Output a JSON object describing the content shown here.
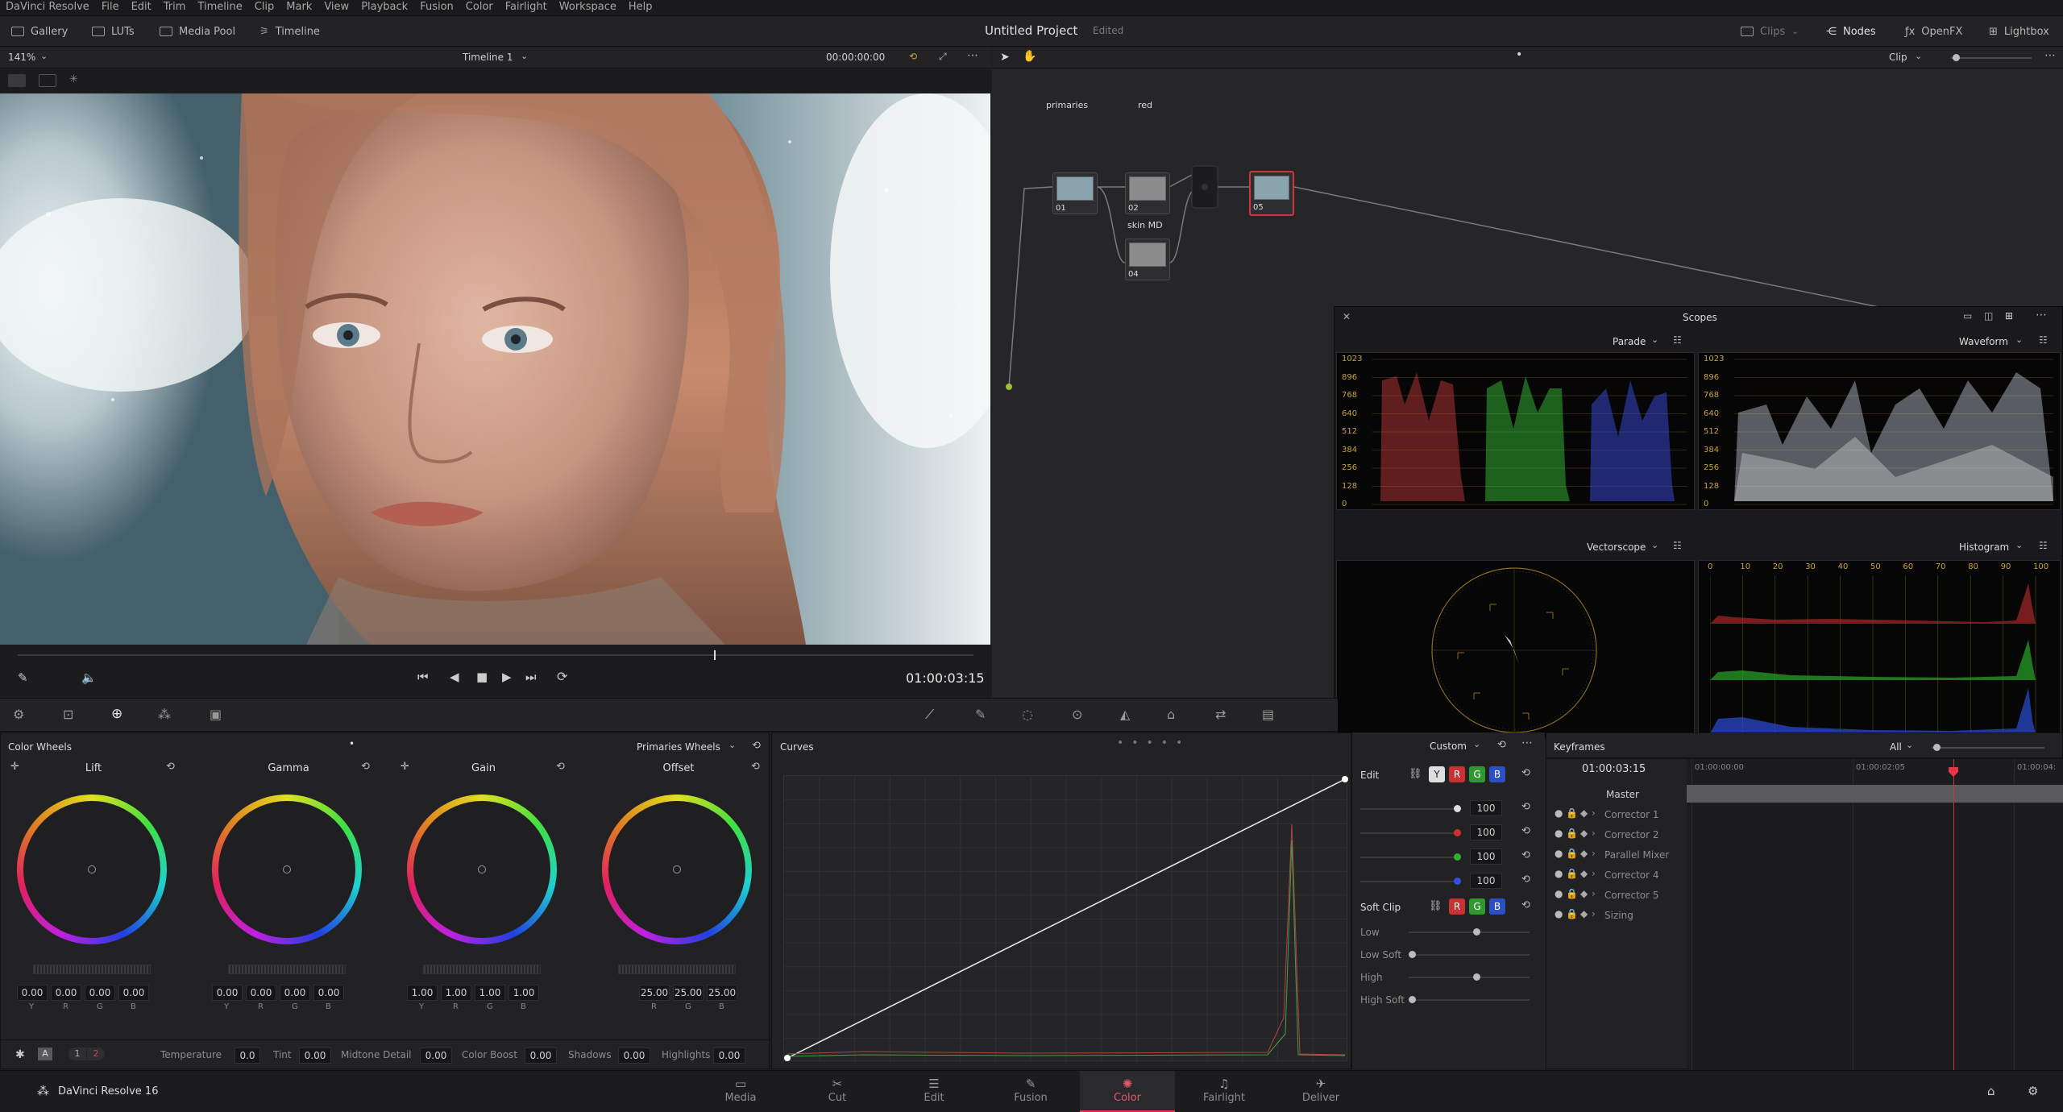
{
  "menubar": {
    "items": [
      "DaVinci Resolve",
      "File",
      "Edit",
      "Trim",
      "Timeline",
      "Clip",
      "Mark",
      "View",
      "Playback",
      "Fusion",
      "Color",
      "Fairlight",
      "Workspace",
      "Help"
    ]
  },
  "toolbar": {
    "gallery": "Gallery",
    "luts": "LUTs",
    "media_pool": "Media Pool",
    "timeline": "Timeline",
    "project_title": "Untitled Project",
    "edited": "Edited",
    "clips": "Clips",
    "nodes": "Nodes",
    "openfx": "OpenFX",
    "lightbox": "Lightbox"
  },
  "viewer": {
    "zoom": "141%",
    "timeline_name": "Timeline 1",
    "timecode_top": "00:00:00:00",
    "timecode": "01:00:03:15"
  },
  "node_editor": {
    "mode": "Clip",
    "nodes": [
      {
        "label": "primaries",
        "num": "01"
      },
      {
        "label": "red",
        "num": "02"
      },
      {
        "label": "skin MD",
        "num": "04"
      },
      {
        "label": "",
        "num": "05"
      }
    ]
  },
  "scopes": {
    "title": "Scopes",
    "parade": "Parade",
    "waveform": "Waveform",
    "vectorscope": "Vectorscope",
    "histogram": "Histogram",
    "y_ticks": [
      "1023",
      "896",
      "768",
      "640",
      "512",
      "384",
      "256",
      "128",
      "0"
    ],
    "hist_ticks": [
      "0",
      "10",
      "20",
      "30",
      "40",
      "50",
      "60",
      "70",
      "80",
      "90",
      "100"
    ]
  },
  "color_wheels": {
    "title": "Color Wheels",
    "mode": "Primaries Wheels",
    "wheels": [
      {
        "name": "Lift",
        "values": [
          "0.00",
          "0.00",
          "0.00",
          "0.00"
        ],
        "labels": [
          "Y",
          "R",
          "G",
          "B"
        ]
      },
      {
        "name": "Gamma",
        "values": [
          "0.00",
          "0.00",
          "0.00",
          "0.00"
        ],
        "labels": [
          "Y",
          "R",
          "G",
          "B"
        ]
      },
      {
        "name": "Gain",
        "values": [
          "1.00",
          "1.00",
          "1.00",
          "1.00"
        ],
        "labels": [
          "Y",
          "R",
          "G",
          "B"
        ]
      },
      {
        "name": "Offset",
        "values": [
          "25.00",
          "25.00",
          "25.00"
        ],
        "labels": [
          "R",
          "G",
          "B"
        ]
      }
    ],
    "bottom": {
      "a": "A",
      "p1": "1",
      "p2": "2",
      "temperature_label": "Temperature",
      "temperature": "0.0",
      "tint_label": "Tint",
      "tint": "0.00",
      "midtone_label": "Midtone Detail",
      "midtone": "0.00",
      "color_boost_label": "Color Boost",
      "color_boost": "0.00",
      "shadows_label": "Shadows",
      "shadows": "0.00",
      "highlights_label": "Highlights",
      "highlights": "0.00"
    }
  },
  "curves": {
    "title": "Curves",
    "mode": "Custom"
  },
  "curves_side": {
    "edit": "Edit",
    "y": "Y",
    "r": "R",
    "g": "G",
    "b": "B",
    "values": [
      "100",
      "100",
      "100",
      "100"
    ],
    "soft_clip": "Soft Clip",
    "low": "Low",
    "low_soft": "Low Soft",
    "high": "High",
    "high_soft": "High Soft"
  },
  "keyframes": {
    "title": "Keyframes",
    "filter": "All",
    "timecode": "01:00:03:15",
    "ruler": [
      "01:00:00:00",
      "01:00:02:05",
      "01:00:04:"
    ],
    "rows": [
      "Master",
      "Corrector 1",
      "Corrector 2",
      "Parallel Mixer",
      "Corrector 4",
      "Corrector 5",
      "Sizing"
    ]
  },
  "bottom_nav": {
    "app": "DaVinci Resolve 16",
    "tabs": [
      {
        "label": "Media",
        "icon": "▭"
      },
      {
        "label": "Cut",
        "icon": "✂"
      },
      {
        "label": "Edit",
        "icon": "☰"
      },
      {
        "label": "Fusion",
        "icon": "✎"
      },
      {
        "label": "Color",
        "icon": "✺"
      },
      {
        "label": "Fairlight",
        "icon": "♫"
      },
      {
        "label": "Deliver",
        "icon": "✈"
      }
    ]
  },
  "colors": {
    "accent": "#e3344a",
    "bg": "#1e1e20",
    "panel": "#222224"
  }
}
